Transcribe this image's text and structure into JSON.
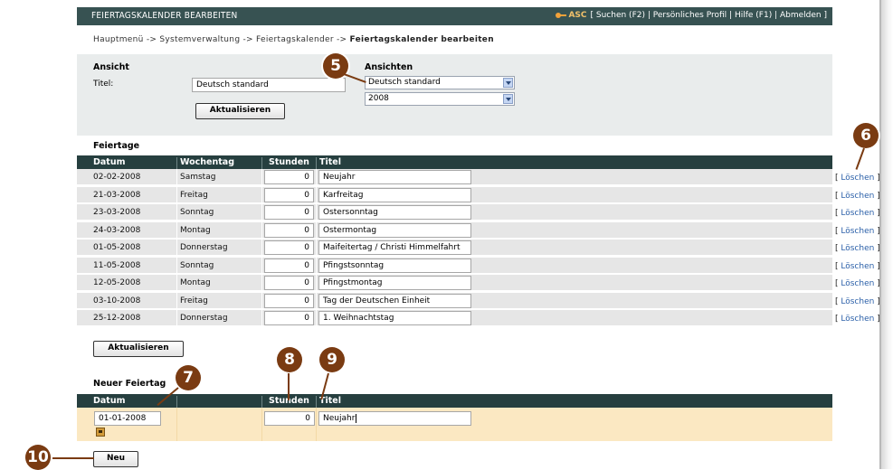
{
  "header": {
    "title": "FEIERTAGSKALENDER BEARBEITEN",
    "user_code": "ASC",
    "links": [
      "[ Suchen (F2)",
      "Persönliches Profil",
      "Hilfe (F1)",
      "Abmelden ]"
    ],
    "link_separator": " | "
  },
  "breadcrumb": {
    "items": [
      "Hauptmenü",
      "Systemverwaltung",
      "Feiertagskalender"
    ],
    "separator": " -> ",
    "current": "Feiertagskalender bearbeiten"
  },
  "ansicht": {
    "heading": "Ansicht",
    "title_label": "Titel:",
    "title_value": "Deutsch standard",
    "update_button": "Aktualisieren"
  },
  "ansichten": {
    "heading": "Ansichten",
    "view_selected": "Deutsch standard",
    "year_selected": "2008"
  },
  "feiertage": {
    "heading": "Feiertage",
    "columns": [
      "Datum",
      "Wochentag",
      "Stunden",
      "Titel"
    ],
    "rows": [
      {
        "date": "02-02-2008",
        "weekday": "Samstag",
        "hours": "0",
        "title": "Neujahr"
      },
      {
        "date": "21-03-2008",
        "weekday": "Freitag",
        "hours": "0",
        "title": "Karfreitag"
      },
      {
        "date": "23-03-2008",
        "weekday": "Sonntag",
        "hours": "0",
        "title": "Ostersonntag"
      },
      {
        "date": "24-03-2008",
        "weekday": "Montag",
        "hours": "0",
        "title": "Ostermontag"
      },
      {
        "date": "01-05-2008",
        "weekday": "Donnerstag",
        "hours": "0",
        "title": "Maifeitertag / Christi Himmelfahrt"
      },
      {
        "date": "11-05-2008",
        "weekday": "Sonntag",
        "hours": "0",
        "title": "Pfingstsonntag"
      },
      {
        "date": "12-05-2008",
        "weekday": "Montag",
        "hours": "0",
        "title": "Pfingstmontag"
      },
      {
        "date": "03-10-2008",
        "weekday": "Freitag",
        "hours": "0",
        "title": "Tag der Deutschen Einheit"
      },
      {
        "date": "25-12-2008",
        "weekday": "Donnerstag",
        "hours": "0",
        "title": "1. Weihnachtstag"
      }
    ],
    "delete_open": "[ ",
    "delete_label": "Löschen",
    "delete_close": " ]",
    "update_button": "Aktualisieren"
  },
  "neuer_feiertag": {
    "heading": "Neuer Feiertag",
    "columns": [
      "Datum",
      "Stunden",
      "Titel"
    ],
    "date_value": "01-01-2008",
    "hours_value": "0",
    "title_value": "Neujahr",
    "new_button": "Neu"
  },
  "callouts": [
    "5",
    "6",
    "7",
    "8",
    "9",
    "10"
  ],
  "colors": {
    "header_bg": "#375252",
    "table_header_bg": "#263f3f",
    "panel_bg": "#e9ecec",
    "row_bg": "#e6e6e6",
    "new_row_bg": "#fbe8c2",
    "callout": "#7a3b12",
    "link": "#2a5fa8"
  }
}
